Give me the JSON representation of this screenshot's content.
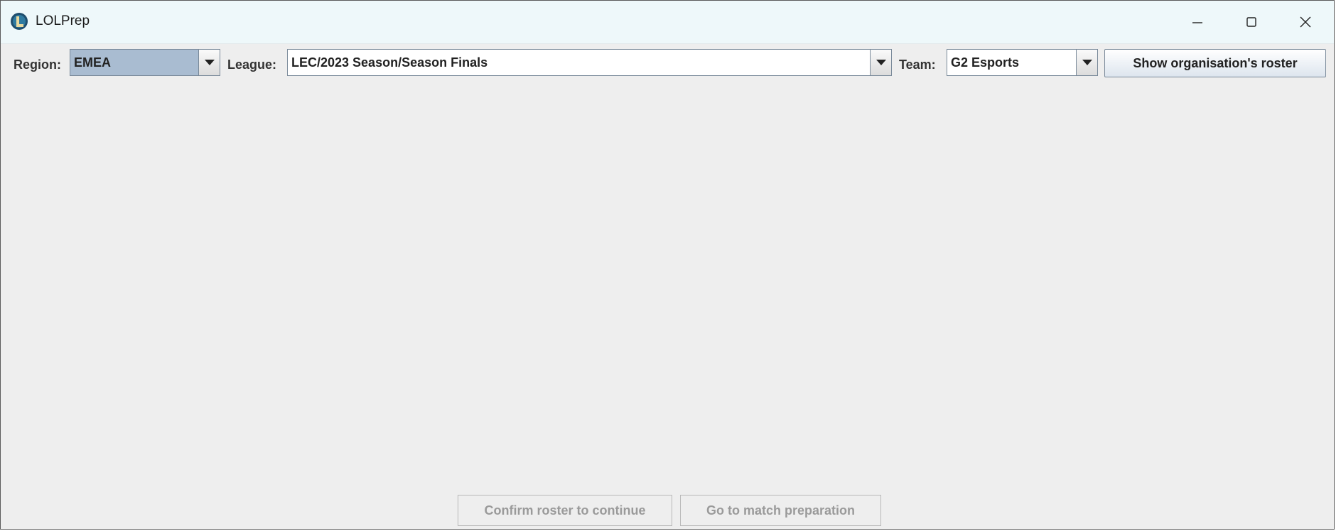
{
  "window": {
    "title": "LOLPrep",
    "icon": "lolprep-logo-icon",
    "controls": {
      "minimize": "minimize-icon",
      "maximize": "maximize-icon",
      "close": "close-icon"
    }
  },
  "toolbar": {
    "region_label": "Region:",
    "region_value": "EMEA",
    "league_label": "League:",
    "league_value": "LEC/2023 Season/Season Finals",
    "team_label": "Team:",
    "team_value": "G2 Esports",
    "roster_button_label": "Show organisation's roster"
  },
  "footer": {
    "confirm_label": "Confirm roster to continue",
    "match_label": "Go to match preparation"
  },
  "colors": {
    "selected_combo_bg": "#a9bcd1",
    "window_bg": "#eeeeee",
    "titlebar_bg": "#eef8fa",
    "disabled_text": "#9a9a9a"
  }
}
